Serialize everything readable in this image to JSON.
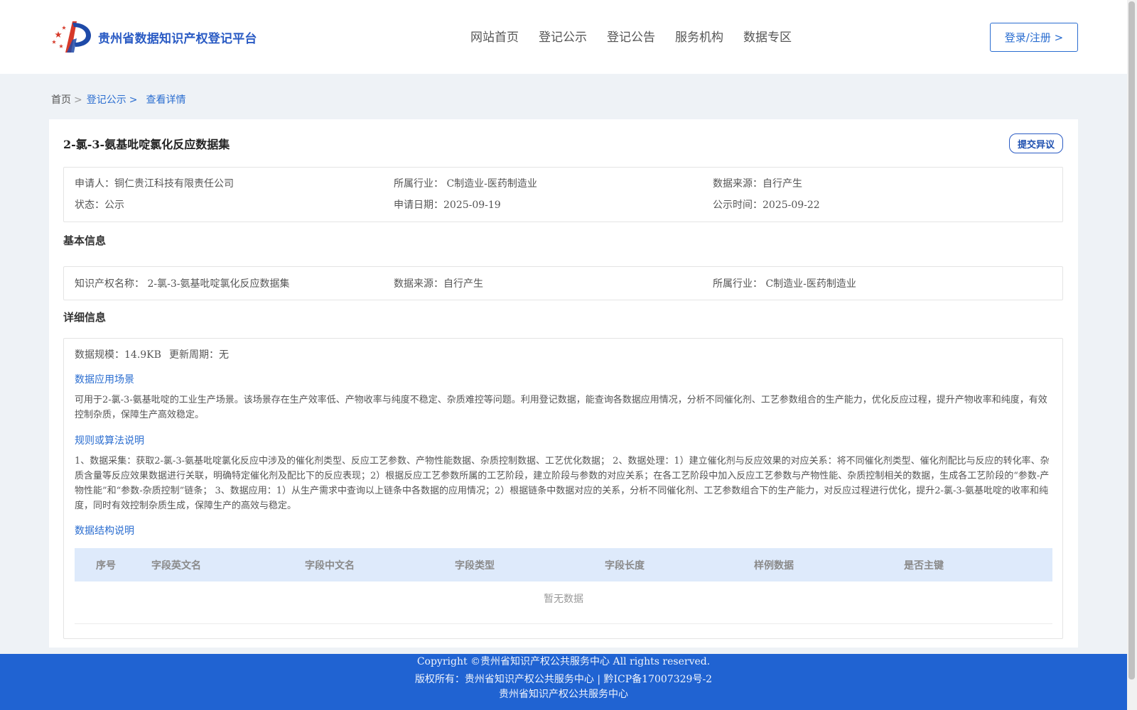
{
  "header": {
    "site_title": "贵州省数据知识产权登记平台",
    "nav": [
      "网站首页",
      "登记公示",
      "登记公告",
      "服务机构",
      "数据专区"
    ],
    "login_label": "登录/注册 >"
  },
  "breadcrumb": {
    "home": "首页",
    "publicity": "登记公示",
    "current": "查看详情",
    "separator": ">"
  },
  "dataset": {
    "title": "2-氯-3-氨基吡啶氯化反应数据集",
    "objection_label": "提交异议"
  },
  "summary": {
    "applicant": "申请人：铜仁贵江科技有限责任公司",
    "industry": "所属行业： C制造业-医药制造业",
    "source": "数据来源：自行产生",
    "status": "状态：公示",
    "apply_date": "申请日期：2025-09-19",
    "publicity_time": "公示时间：2025-09-22"
  },
  "basic": {
    "section_title": "基本信息",
    "ip_name": "知识产权名称： 2-氯-3-氨基吡啶氯化反应数据集",
    "source": "数据来源：自行产生",
    "industry": "所属行业： C制造业-医药制造业"
  },
  "detail": {
    "section_title": "详细信息",
    "scale": "数据规模：14.9KB",
    "update_cycle": "更新周期：无",
    "scenario_title": "数据应用场景",
    "scenario_text": "可用于2-氯-3-氨基吡啶的工业生产场景。该场景存在生产效率低、产物收率与纯度不稳定、杂质难控等问题。利用登记数据，能查询各数据应用情况，分析不同催化剂、工艺参数组合的生产能力，优化反应过程，提升产物收率和纯度，有效控制杂质，保障生产高效稳定。",
    "algorithm_title": "规则或算法说明",
    "algorithm_text": "1、数据采集：获取2-氯-3-氨基吡啶氯化反应中涉及的催化剂类型、反应工艺参数、产物性能数据、杂质控制数据、工艺优化数据； 2、数据处理：1）建立催化剂与反应效果的对应关系：将不同催化剂类型、催化剂配比与反应的转化率、杂质含量等反应效果数据进行关联，明确特定催化剂及配比下的反应表现；2）根据反应工艺参数所属的工艺阶段，建立阶段与参数的对应关系；在各工艺阶段中加入反应工艺参数与产物性能、杂质控制相关的数据，生成各工艺阶段的“参数-产物性能”和“参数-杂质控制”链条； 3、数据应用：1）从生产需求中查询以上链条中各数据的应用情况；2）根据链条中数据对应的关系，分析不同催化剂、工艺参数组合下的生产能力，对反应过程进行优化，提升2-氯-3-氨基吡啶的收率和纯度，同时有效控制杂质生成，保障生产的高效与稳定。",
    "structure_title": "数据结构说明",
    "table_headers": [
      "序号",
      "字段英文名",
      "字段中文名",
      "字段类型",
      "字段长度",
      "样例数据",
      "是否主键"
    ],
    "empty_text": "暂无数据"
  },
  "footer": {
    "copyright": "Copyright ©贵州省知识产权公共服务中心 All rights reserved.",
    "owner": "版权所有：贵州省知识产权公共服务中心 | 黔ICP备17007329号-2",
    "org": "贵州省知识产权公共服务中心"
  },
  "colors": {
    "primary": "#2a6dd0",
    "footer_bg": "#2063d2",
    "page_bg": "#eef2f6",
    "table_head_bg": "#deeafb"
  }
}
